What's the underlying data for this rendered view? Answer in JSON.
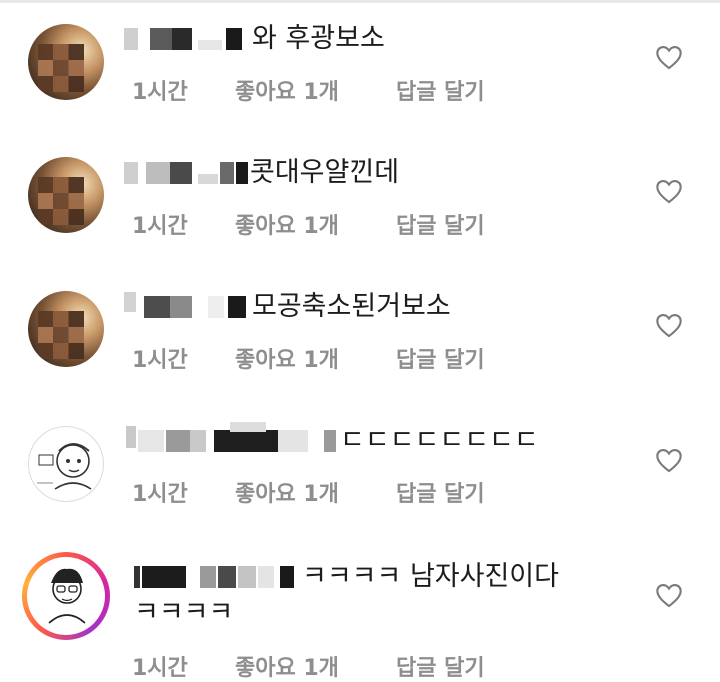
{
  "comments": [
    {
      "text": "와 후광보소",
      "time": "1시간",
      "likes": "좋아요 1개",
      "reply": "답글 달기",
      "avatar": "blurred-photo"
    },
    {
      "text": "콧대우얄낀데",
      "time": "1시간",
      "likes": "좋아요 1개",
      "reply": "답글 달기",
      "avatar": "blurred-photo"
    },
    {
      "text": "모공축소된거보소",
      "time": "1시간",
      "likes": "좋아요 1개",
      "reply": "답글 달기",
      "avatar": "blurred-photo"
    },
    {
      "text": "ㄷㄷㄷㄷㄷㄷㄷㄷ",
      "time": "1시간",
      "likes": "좋아요 1개",
      "reply": "답글 달기",
      "avatar": "sketch-portrait"
    },
    {
      "text": "ㅋㅋㅋㅋ 남자사진이다",
      "text2": "ㅋㅋㅋㅋ",
      "time": "1시간",
      "likes": "좋아요 1개",
      "reply": "답글 달기",
      "avatar": "story-ring-sketch"
    }
  ],
  "icons": {
    "like": "heart-outline-icon"
  },
  "colors": {
    "text": "#1c1c1c",
    "meta": "#8e8e8e",
    "heart": "#7a7a7a"
  }
}
